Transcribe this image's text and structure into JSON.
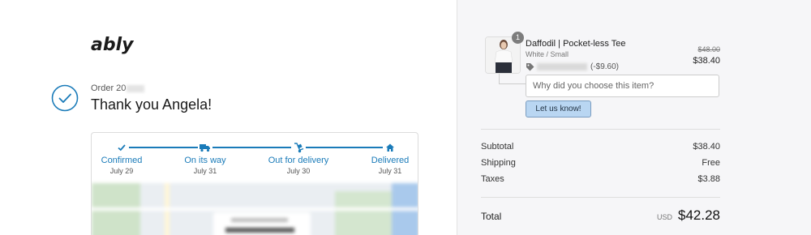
{
  "brand": {
    "logo_text": "ably",
    "accent": "#1a7bb9"
  },
  "order": {
    "number_prefix": "Order 20",
    "thanks": "Thank you Angela!"
  },
  "tracking": {
    "steps": [
      {
        "label": "Confirmed",
        "date": "July 29",
        "icon": "check-icon"
      },
      {
        "label": "On its way",
        "date": "July 31",
        "icon": "truck-icon"
      },
      {
        "label": "Out for delivery",
        "date": "July 30",
        "icon": "hand-truck-icon"
      },
      {
        "label": "Delivered",
        "date": "July 31",
        "icon": "home-icon"
      }
    ]
  },
  "cart": {
    "item": {
      "quantity": "1",
      "name": "Daffodil | Pocket-less Tee",
      "variant": "White / Small",
      "original_price": "$48.00",
      "price": "$38.40",
      "discount_amount": "(-$9.60)"
    },
    "feedback": {
      "placeholder": "Why did you choose this item?",
      "button_label": "Let us know!"
    }
  },
  "summary": {
    "subtotal_label": "Subtotal",
    "subtotal_value": "$38.40",
    "shipping_label": "Shipping",
    "shipping_value": "Free",
    "taxes_label": "Taxes",
    "taxes_value": "$3.88",
    "total_label": "Total",
    "currency": "USD",
    "total_value": "$42.28"
  }
}
